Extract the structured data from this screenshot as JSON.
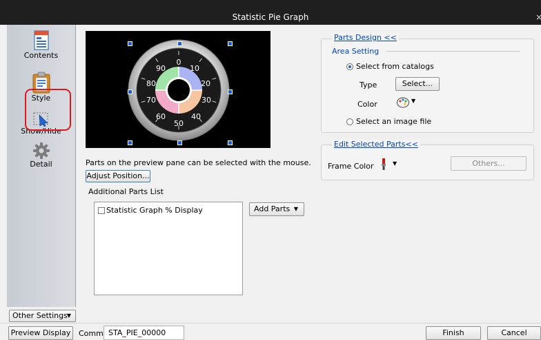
{
  "window": {
    "title": "Statistic Pie Graph",
    "close_glyph": "×"
  },
  "sidebar": {
    "items": [
      {
        "label": "Contents",
        "icon": "contents-icon"
      },
      {
        "label": "Style",
        "icon": "style-icon",
        "highlighted": true
      },
      {
        "label": "Show/Hide",
        "icon": "show-hide-icon"
      },
      {
        "label": "Detail",
        "icon": "gear-icon"
      }
    ],
    "other_settings_label": "Other Settings"
  },
  "preview": {
    "dial_numbers": [
      "0",
      "10",
      "20",
      "30",
      "40",
      "50",
      "60",
      "70",
      "80",
      "90"
    ],
    "hint": "Parts on the preview pane can be selected with the mouse."
  },
  "adjust_position_label": "Adjust Position...",
  "additional_parts": {
    "title": "Additional Parts List",
    "items": [
      {
        "label": "Statistic Graph % Display",
        "checked": false
      }
    ],
    "add_parts_label": "Add Parts"
  },
  "parts_design": {
    "title": "Parts Design <<",
    "area_setting_title": "Area Setting",
    "select_from_catalogs": "Select from catalogs",
    "type_label": "Type",
    "select_button": "Select...",
    "color_label": "Color",
    "select_image_file": "Select an image file",
    "selected_option": "Select from catalogs"
  },
  "edit_selected_parts": {
    "title": "Edit Selected Parts<<",
    "frame_color_label": "Frame Color",
    "others_button": "Others..."
  },
  "bottom": {
    "preview_display_label": "Preview Display",
    "comm_label": "Comm",
    "comm_value": "STA_PIE_00000",
    "finish_label": "Finish",
    "cancel_label": "Cancel"
  },
  "colors": {
    "pie_green": "#9fe3a6",
    "pie_blue": "#aab4f5",
    "pie_pink": "#f3a9c8",
    "pie_orange": "#f7c59f",
    "highlight_red": "#e0161c",
    "link_blue": "#0045c8"
  }
}
